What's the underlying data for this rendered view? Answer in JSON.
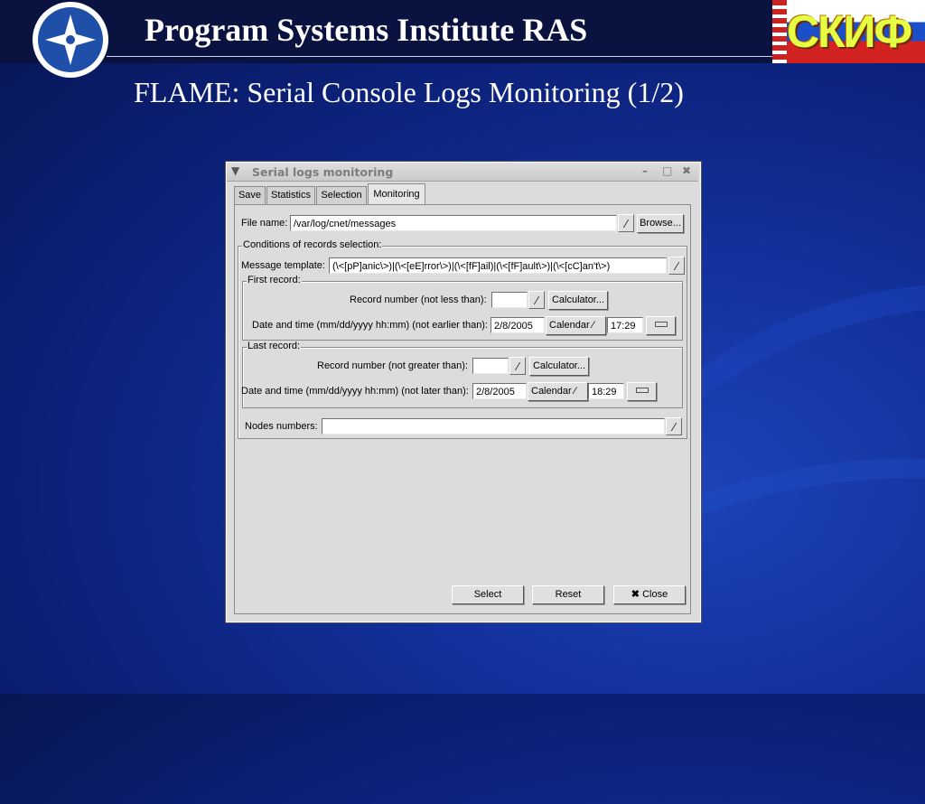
{
  "slide": {
    "header_title": "Program Systems Institute RAS",
    "brand_text": "СКИФ",
    "subtitle": "FLAME: Serial Console Logs Monitoring (1/2)"
  },
  "window": {
    "title": "Serial logs monitoring",
    "controls": {
      "minimize": "–",
      "maximize": "□",
      "close": "✖"
    },
    "tabs": [
      {
        "label": "Save",
        "active": false
      },
      {
        "label": "Statistics",
        "active": false
      },
      {
        "label": "Selection",
        "active": false
      },
      {
        "label": "Monitoring",
        "active": true
      }
    ],
    "file": {
      "label": "File name:",
      "value": "/var/log/cnet/messages",
      "browse_label": "Browse..."
    },
    "conditions": {
      "title": "Conditions of records selection:",
      "template_label": "Message template:",
      "template_value": "(\\<[pP]anic\\>)|(\\<[eE]rror\\>)|(\\<[fF]ail)|(\\<[fF]ault\\>)|(\\<[cC]an't\\>)",
      "first_record": {
        "title": "First record:",
        "number_label": "Record number (not less than):",
        "number_value": "",
        "calculator_label": "Calculator...",
        "date_label": "Date and time (mm/dd/yyyy  hh:mm) (not earlier than):",
        "date_value": "2/8/2005",
        "calendar_label": "Calendar",
        "time_value": "17:29"
      },
      "last_record": {
        "title": "Last record:",
        "number_label": "Record number (not greater than):",
        "number_value": "",
        "calculator_label": "Calculator...",
        "date_label": "Date and time (mm/dd/yyyy  hh:mm) (not later than):",
        "date_value": "2/8/2005",
        "calendar_label": "Calendar",
        "time_value": "18:29"
      },
      "nodes_label": "Nodes numbers:",
      "nodes_value": ""
    },
    "buttons": {
      "select": "Select",
      "reset": "Reset",
      "close": "Close"
    }
  }
}
